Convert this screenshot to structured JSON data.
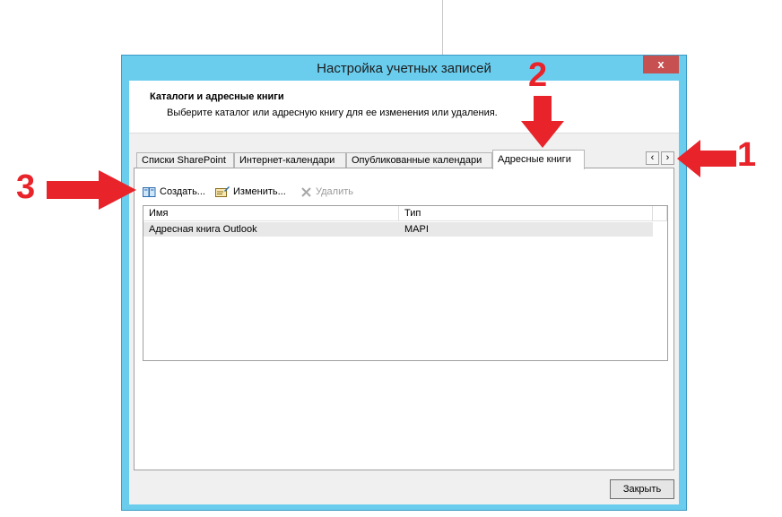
{
  "window": {
    "title": "Настройка учетных записей",
    "close_label": "x"
  },
  "header": {
    "title": "Каталоги и адресные книги",
    "subtitle": "Выберите каталог или адресную книгу для ее изменения или удаления."
  },
  "tabs": [
    {
      "label": "Списки SharePoint",
      "active": false
    },
    {
      "label": "Интернет-календари",
      "active": false
    },
    {
      "label": "Опубликованные календари",
      "active": false
    },
    {
      "label": "Адресные книги",
      "active": true
    }
  ],
  "tab_nav": {
    "prev": "‹",
    "next": "›"
  },
  "toolbar": {
    "create_label": "Создать...",
    "edit_label": "Изменить...",
    "delete_label": "Удалить"
  },
  "list": {
    "columns": [
      "Имя",
      "Тип"
    ],
    "rows": [
      {
        "name": "Адресная книга Outlook",
        "type": "MAPI"
      }
    ]
  },
  "footer": {
    "close_label": "Закрыть"
  },
  "annotations": {
    "one": "1",
    "two": "2",
    "three": "3",
    "color": "#e8232a"
  }
}
